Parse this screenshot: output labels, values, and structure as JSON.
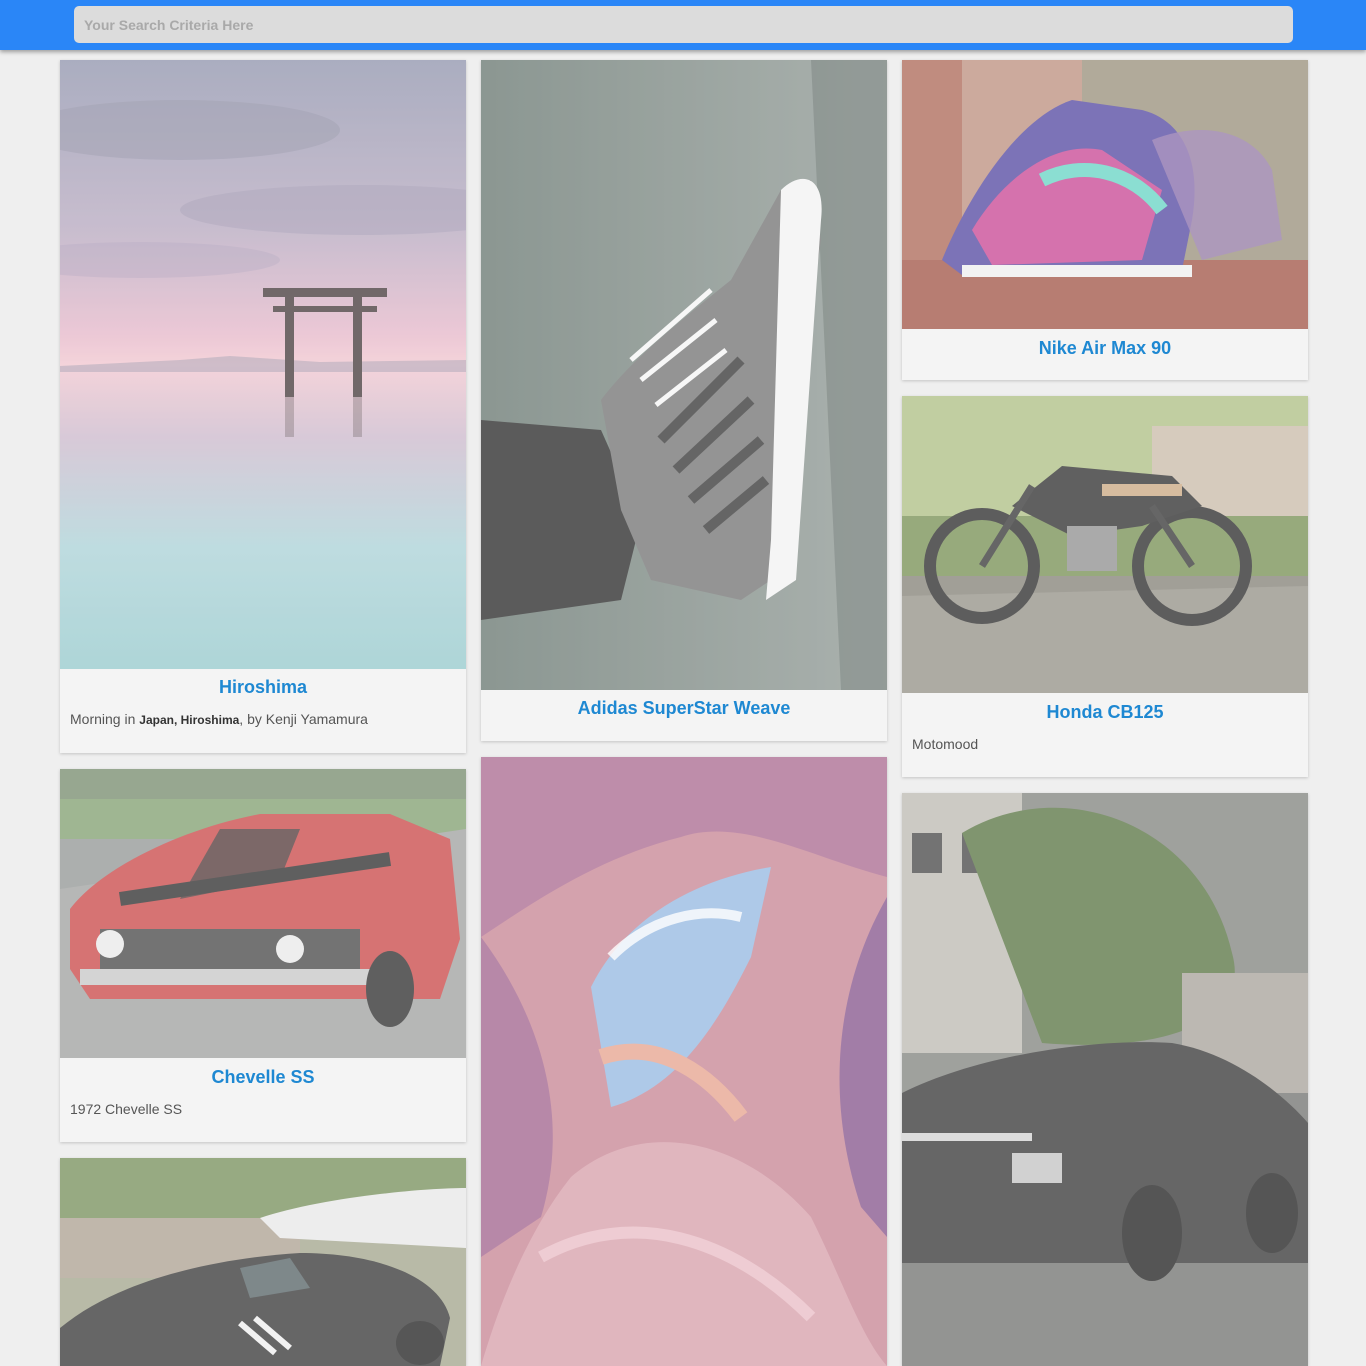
{
  "search": {
    "placeholder": "Your Search Criteria Here"
  },
  "cards": [
    {
      "title": "Hiroshima",
      "desc": {
        "prefix": "Morning in ",
        "place": "Japan, Hiroshima",
        "suffix": ", by Kenji Yamamura"
      }
    },
    {
      "title": "Adidas SuperStar Weave"
    },
    {
      "title": "Nike Air Max 90"
    },
    {
      "title": "Honda CB125",
      "desc": "Motomood"
    },
    {
      "title": "Chevelle SS",
      "desc": "1972 Chevelle SS"
    },
    {
      "title": ""
    },
    {
      "title": ""
    },
    {
      "title": ""
    }
  ],
  "colors": {
    "accent": "#2a86f7",
    "title": "#1e88d2"
  }
}
